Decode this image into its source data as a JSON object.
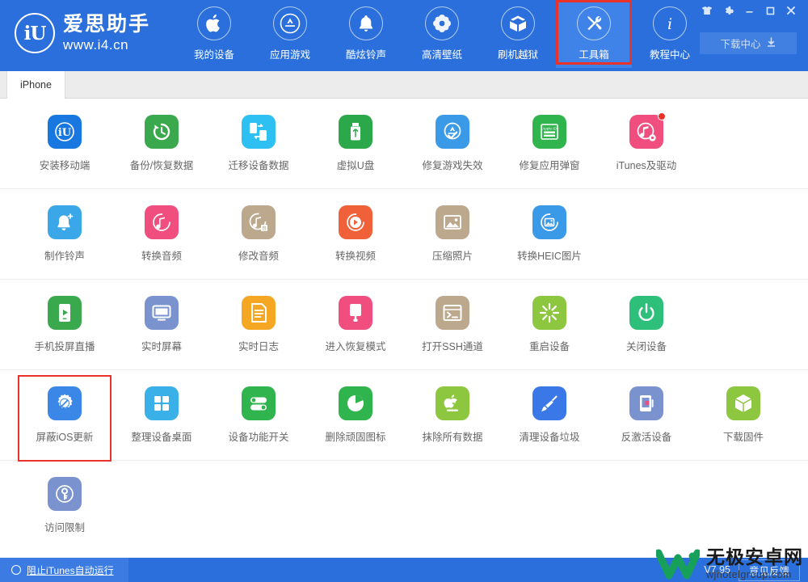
{
  "header": {
    "brand": {
      "logo_text": "iU",
      "name": "爱思助手",
      "url": "www.i4.cn"
    },
    "nav": [
      {
        "label": "我的设备",
        "icon": "apple-icon",
        "state": "normal"
      },
      {
        "label": "应用游戏",
        "icon": "appstore-icon",
        "state": "normal"
      },
      {
        "label": "酷炫铃声",
        "icon": "bell-icon",
        "state": "normal"
      },
      {
        "label": "高清壁纸",
        "icon": "flower-icon",
        "state": "normal"
      },
      {
        "label": "刷机越狱",
        "icon": "open-box-icon",
        "state": "normal"
      },
      {
        "label": "工具箱",
        "icon": "tools-icon",
        "state": "active-highlighted"
      },
      {
        "label": "教程中心",
        "icon": "info-icon",
        "state": "normal"
      }
    ],
    "window_controls": [
      {
        "name": "skin-icon",
        "glyph": "shirt"
      },
      {
        "name": "settings-icon",
        "glyph": "gear"
      },
      {
        "name": "minimize-icon",
        "glyph": "minimize"
      },
      {
        "name": "maximize-icon",
        "glyph": "maximize"
      },
      {
        "name": "close-icon",
        "glyph": "close"
      }
    ],
    "download_center": {
      "label": "下载中心",
      "icon": "download-icon"
    }
  },
  "tabs": [
    {
      "label": "iPhone",
      "active": true
    }
  ],
  "tool_rows": [
    [
      {
        "label": "安装移动端",
        "icon": "i4-app-icon",
        "color": "#1878e0"
      },
      {
        "label": "备份/恢复数据",
        "icon": "restore-clock-icon",
        "color": "#3aa94e"
      },
      {
        "label": "迁移设备数据",
        "icon": "device-transfer-icon",
        "color": "#2ec0f2"
      },
      {
        "label": "虚拟U盘",
        "icon": "usb-drive-icon",
        "color": "#2aa84a"
      },
      {
        "label": "修复游戏失效",
        "icon": "appstore-fix-icon",
        "color": "#3a9ae8"
      },
      {
        "label": "修复应用弹窗",
        "icon": "apple-id-icon",
        "color": "#2fb44e"
      },
      {
        "label": "iTunes及驱动",
        "icon": "itunes-driver-icon",
        "color": "#ef4e7f",
        "badge": true
      }
    ],
    [
      {
        "label": "制作铃声",
        "icon": "bell-plus-icon",
        "color": "#3aa8e8"
      },
      {
        "label": "转换音频",
        "icon": "audio-convert-icon",
        "color": "#ef4e7f"
      },
      {
        "label": "修改音频",
        "icon": "audio-edit-icon",
        "color": "#bba88d"
      },
      {
        "label": "转换视频",
        "icon": "video-convert-icon",
        "color": "#f0613a"
      },
      {
        "label": "压缩照片",
        "icon": "compress-photo-icon",
        "color": "#bba88d"
      },
      {
        "label": "转换HEIC图片",
        "icon": "heic-convert-icon",
        "color": "#3a9ae8"
      }
    ],
    [
      {
        "label": "手机投屏直播",
        "icon": "screen-cast-icon",
        "color": "#3aa94e"
      },
      {
        "label": "实时屏幕",
        "icon": "monitor-icon",
        "color": "#7a93cf"
      },
      {
        "label": "实时日志",
        "icon": "log-document-icon",
        "color": "#f5a623"
      },
      {
        "label": "进入恢复模式",
        "icon": "recovery-mode-icon",
        "color": "#ef4e7f"
      },
      {
        "label": "打开SSH通道",
        "icon": "ssh-terminal-icon",
        "color": "#bba88d"
      },
      {
        "label": "重启设备",
        "icon": "restart-icon",
        "color": "#8dc63f"
      },
      {
        "label": "关闭设备",
        "icon": "power-off-icon",
        "color": "#2ec07a"
      }
    ],
    [
      {
        "label": "屏蔽iOS更新",
        "icon": "block-update-icon",
        "color": "#3a87e8",
        "highlighted": true
      },
      {
        "label": "整理设备桌面",
        "icon": "grid-tiles-icon",
        "color": "#3ab0e8"
      },
      {
        "label": "设备功能开关",
        "icon": "toggle-switch-icon",
        "color": "#2fb44e"
      },
      {
        "label": "删除顽固图标",
        "icon": "pie-delete-icon",
        "color": "#2fb44e"
      },
      {
        "label": "抹除所有数据",
        "icon": "erase-apple-icon",
        "color": "#8dc63f"
      },
      {
        "label": "清理设备垃圾",
        "icon": "clean-broom-icon",
        "color": "#3a78e8"
      },
      {
        "label": "反激活设备",
        "icon": "deactivate-device-icon",
        "color": "#7a93cf"
      },
      {
        "label": "下载固件",
        "icon": "firmware-box-icon",
        "color": "#8dc63f"
      }
    ],
    [
      {
        "label": "访问限制",
        "icon": "key-lock-icon",
        "color": "#7a93cf"
      }
    ]
  ],
  "statusbar": {
    "itunes_block_label": "阻止iTunes自动运行",
    "version": "V7.95",
    "feedback_label": "意见反馈"
  },
  "watermark": {
    "title": "无极安卓网",
    "subtitle": "wjhotelgroup.com"
  },
  "colors": {
    "header_blue": "#2a6fdb",
    "accent_red": "#e8322a",
    "tab_gray": "#ececec"
  }
}
